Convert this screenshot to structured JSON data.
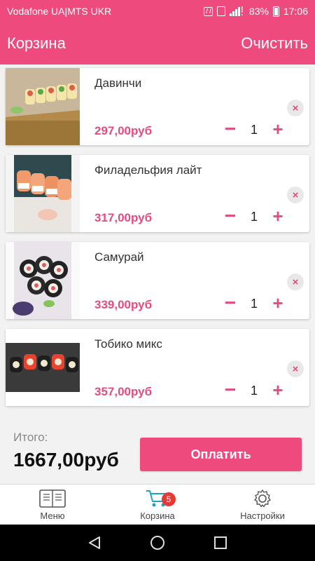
{
  "status_bar": {
    "carrier": "Vodafone UA|MTS UKR",
    "battery": "83%",
    "time": "17:06"
  },
  "header": {
    "title": "Корзина",
    "clear_label": "Очистить"
  },
  "items": [
    {
      "name": "Давинчи",
      "price": "297,00руб",
      "quantity": "1"
    },
    {
      "name": "Филадельфия лайт",
      "price": "317,00руб",
      "quantity": "1"
    },
    {
      "name": "Самурай",
      "price": "339,00руб",
      "quantity": "1"
    },
    {
      "name": "Тобико микс",
      "price": "357,00руб",
      "quantity": "1"
    }
  ],
  "controls": {
    "minus": "−",
    "plus": "+",
    "remove": "×"
  },
  "total": {
    "label": "Итого:",
    "value": "1667,00руб",
    "pay_label": "Оплатить"
  },
  "bottom_nav": {
    "items": [
      {
        "label": "Меню",
        "icon": "menu-book-icon"
      },
      {
        "label": "Корзина",
        "icon": "cart-icon",
        "badge": "5"
      },
      {
        "label": "Настройки",
        "icon": "gear-icon"
      }
    ]
  },
  "colors": {
    "accent": "#ef4a7e",
    "price": "#e24c82",
    "badge": "#e53935"
  }
}
